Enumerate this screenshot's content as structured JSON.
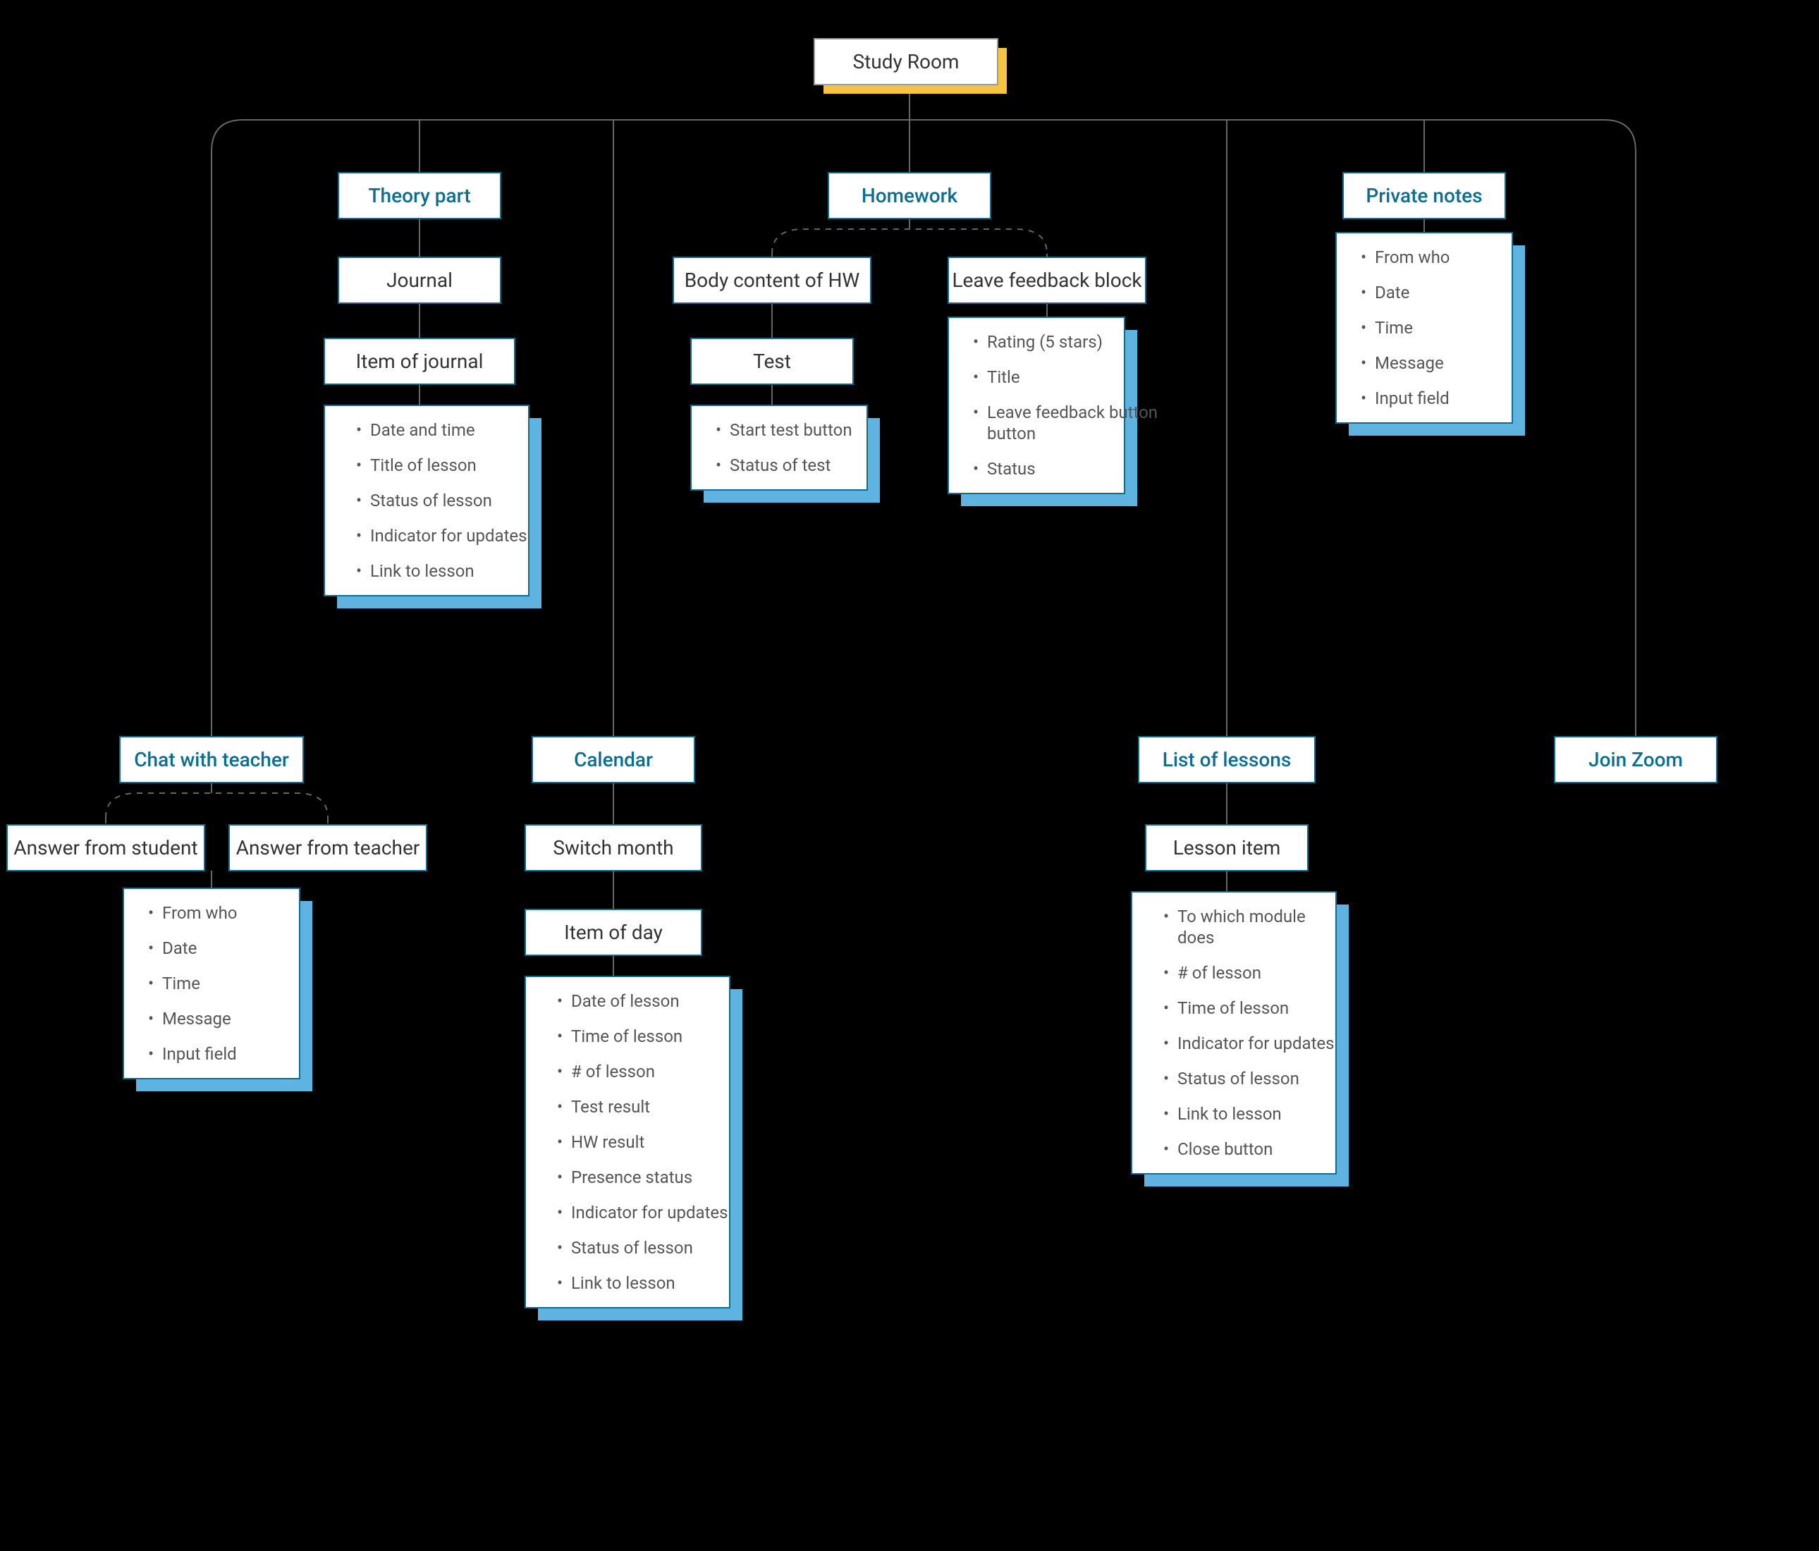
{
  "root": {
    "label": "Study Room"
  },
  "theory": {
    "label": "Theory part",
    "journal": "Journal",
    "item": "Item of journal",
    "items": [
      "Date and time",
      "Title of lesson",
      "Status of lesson",
      "Indicator for updates",
      "Link to lesson"
    ]
  },
  "homework": {
    "label": "Homework",
    "body": "Body content of HW",
    "test": "Test",
    "test_items": [
      "Start test button",
      "Status of test"
    ],
    "feedback": "Leave feedback block",
    "feedback_items": [
      "Rating (5 stars)",
      "Title",
      "Leave feedback button",
      "Status"
    ]
  },
  "private_notes": {
    "label": "Private notes",
    "items": [
      "From who",
      "Date",
      "Time",
      "Message",
      "Input field"
    ]
  },
  "chat": {
    "label": "Chat with teacher",
    "student": "Answer from student",
    "teacher": "Answer from teacher",
    "items": [
      "From who",
      "Date",
      "Time",
      "Message",
      "Input field"
    ]
  },
  "calendar": {
    "label": "Calendar",
    "switch": "Switch month",
    "item": "Item of day",
    "items": [
      "Date of lesson",
      "Time of lesson",
      "# of lesson",
      "Test result",
      "HW result",
      "Presence status",
      "Indicator for updates",
      "Status of lesson",
      "Link to lesson"
    ]
  },
  "lessons": {
    "label": "List of lessons",
    "item": "Lesson item",
    "items": [
      "To which module does",
      "# of lesson",
      "Time of lesson",
      "Indicator for updates",
      "Status of lesson",
      "Link to lesson",
      "Close button"
    ]
  },
  "zoom": {
    "label": "Join Zoom"
  }
}
